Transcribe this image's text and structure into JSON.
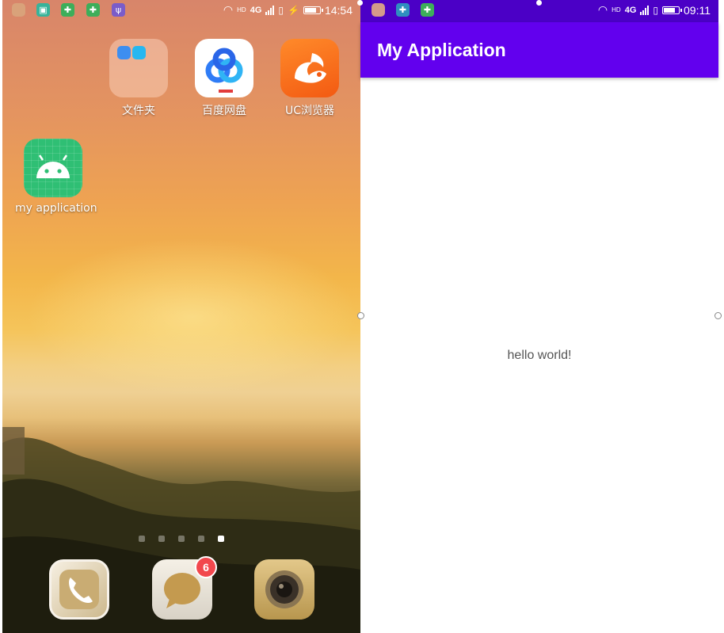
{
  "left_screen": {
    "status_bar": {
      "network_hd": "HD",
      "network_type": "4G",
      "time": "14:54",
      "battery_level": 0.8
    },
    "apps": [
      {
        "label": "文件夹",
        "icon": "folder-icon"
      },
      {
        "label": "百度网盘",
        "icon": "baidu-netdisk-icon"
      },
      {
        "label": "UC浏览器",
        "icon": "uc-browser-icon"
      },
      {
        "label": "my application",
        "icon": "android-icon"
      }
    ],
    "page_indicator": {
      "count": 5,
      "active": 5
    },
    "dock": [
      {
        "icon": "phone-icon"
      },
      {
        "icon": "messages-icon",
        "badge": "6"
      },
      {
        "icon": "camera-icon"
      }
    ]
  },
  "right_screen": {
    "status_bar": {
      "network_hd": "HD",
      "network_type": "4G",
      "time": "09:11",
      "battery_level": 0.8
    },
    "app_bar": {
      "title": "My Application"
    },
    "content": {
      "text": "hello world!"
    }
  },
  "colors": {
    "primary": "#6200ee",
    "primary_dark": "#4b00c6",
    "badge_red": "#f2474d",
    "android_green": "#2fbf74"
  }
}
